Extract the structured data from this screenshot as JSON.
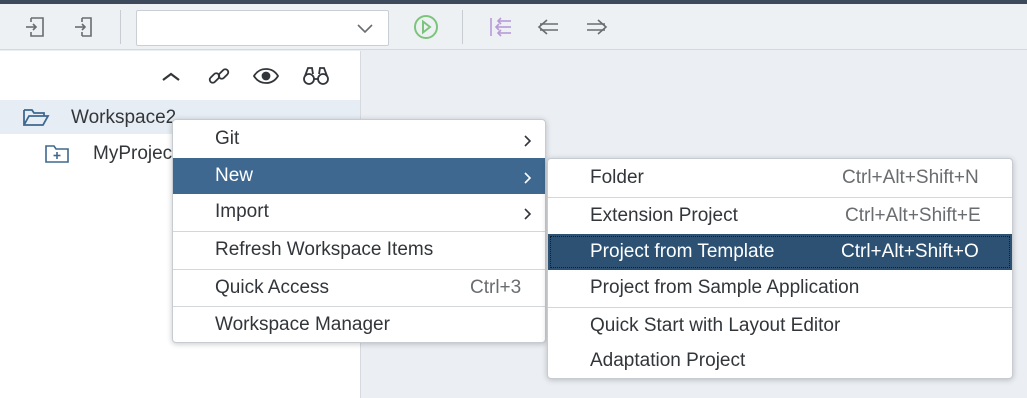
{
  "toolbar": {
    "combo_value": "",
    "icons": [
      "import-icon",
      "export-icon",
      "chevron-down-icon",
      "run-icon",
      "sync-icon",
      "back-arrow-icon",
      "forward-arrow-icon"
    ]
  },
  "tree_toolbar": {
    "icons": [
      "collapse-icon",
      "link-icon",
      "eye-icon",
      "binoculars-icon"
    ]
  },
  "tree": {
    "items": [
      {
        "label": "Workspace2",
        "icon": "folder-open-icon"
      },
      {
        "label": "MyProject",
        "icon": "project-folder-icon"
      }
    ]
  },
  "context_menu": {
    "items": [
      {
        "label": "Git",
        "submenu": true
      },
      {
        "label": "New",
        "submenu": true
      },
      {
        "label": "Import",
        "submenu": true
      },
      {
        "label": "Refresh Workspace Items"
      },
      {
        "label": "Quick Access",
        "shortcut": "Ctrl+3"
      },
      {
        "label": "Workspace Manager"
      }
    ]
  },
  "new_submenu": {
    "items": [
      {
        "label": "Folder",
        "shortcut": "Ctrl+Alt+Shift+N"
      },
      {
        "label": "Extension Project",
        "shortcut": "Ctrl+Alt+Shift+E"
      },
      {
        "label": "Project from Template",
        "shortcut": "Ctrl+Alt+Shift+O"
      },
      {
        "label": "Project from Sample Application"
      },
      {
        "label": "Quick Start with Layout Editor"
      },
      {
        "label": "Adaptation Project"
      }
    ]
  },
  "colors": {
    "highlight": "#3e6890",
    "selected": "#2c5173",
    "run_icon": "#7cc47c",
    "sync_icon": "#b89ad8"
  }
}
